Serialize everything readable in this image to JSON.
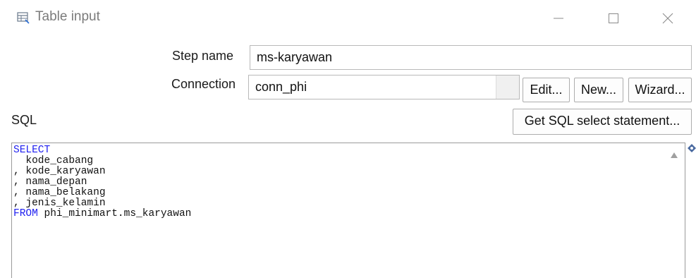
{
  "window": {
    "title": "Table input",
    "icon": "table-input-icon",
    "controls": [
      "minimize-icon",
      "maximize-icon",
      "close-icon"
    ]
  },
  "form": {
    "step_name_label": "Step name",
    "step_name_value": "ms-karyawan",
    "connection_label": "Connection",
    "connection_value": "conn_phi",
    "edit_button": "Edit...",
    "new_button": "New...",
    "wizard_button": "Wizard...",
    "sql_label": "SQL",
    "get_sql_button": "Get SQL select statement..."
  },
  "sql": {
    "lines": [
      {
        "keyword": "SELECT",
        "text": ""
      },
      {
        "keyword": "",
        "text": "  kode_cabang"
      },
      {
        "keyword": "",
        "text": ", kode_karyawan"
      },
      {
        "keyword": "",
        "text": ", nama_depan"
      },
      {
        "keyword": "",
        "text": ", nama_belakang"
      },
      {
        "keyword": "",
        "text": ", jenis_kelamin"
      },
      {
        "keyword": "FROM",
        "text": " phi_minimart.ms_karyawan"
      }
    ]
  },
  "colors": {
    "sql_keyword": "#1e1ef0",
    "title_text": "#7b7b7b"
  }
}
